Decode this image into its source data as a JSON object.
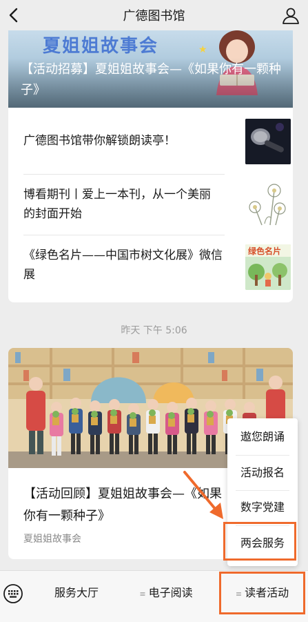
{
  "nav": {
    "title": "广德图书馆"
  },
  "top_card": {
    "banner_text": "夏姐姐故事会",
    "hero_title": "【活动招募】夏姐姐故事会—《如果你有一颗种子》",
    "articles": [
      {
        "title": "广德图书馆带你解锁朗读亭！"
      },
      {
        "title": "博看期刊丨爱上一本刊，从一个美丽的封面开始"
      },
      {
        "title": "《绿色名片——中国市树文化展》微信展"
      }
    ]
  },
  "timestamp": "昨天 下午 5:06",
  "bottom_card": {
    "title": "【活动回顾】夏姐姐故事会—《如果你有一颗种子》",
    "source": "夏姐姐故事会"
  },
  "popup_menu": {
    "items": [
      "遨您朗诵",
      "活动报名",
      "数字党建",
      "两会服务"
    ]
  },
  "tabbar": {
    "tabs": [
      "服务大厅",
      "电子阅读",
      "读者活动"
    ]
  },
  "colors": {
    "highlight": "#ef6a2c",
    "banner_text": "#4d7bd3"
  }
}
